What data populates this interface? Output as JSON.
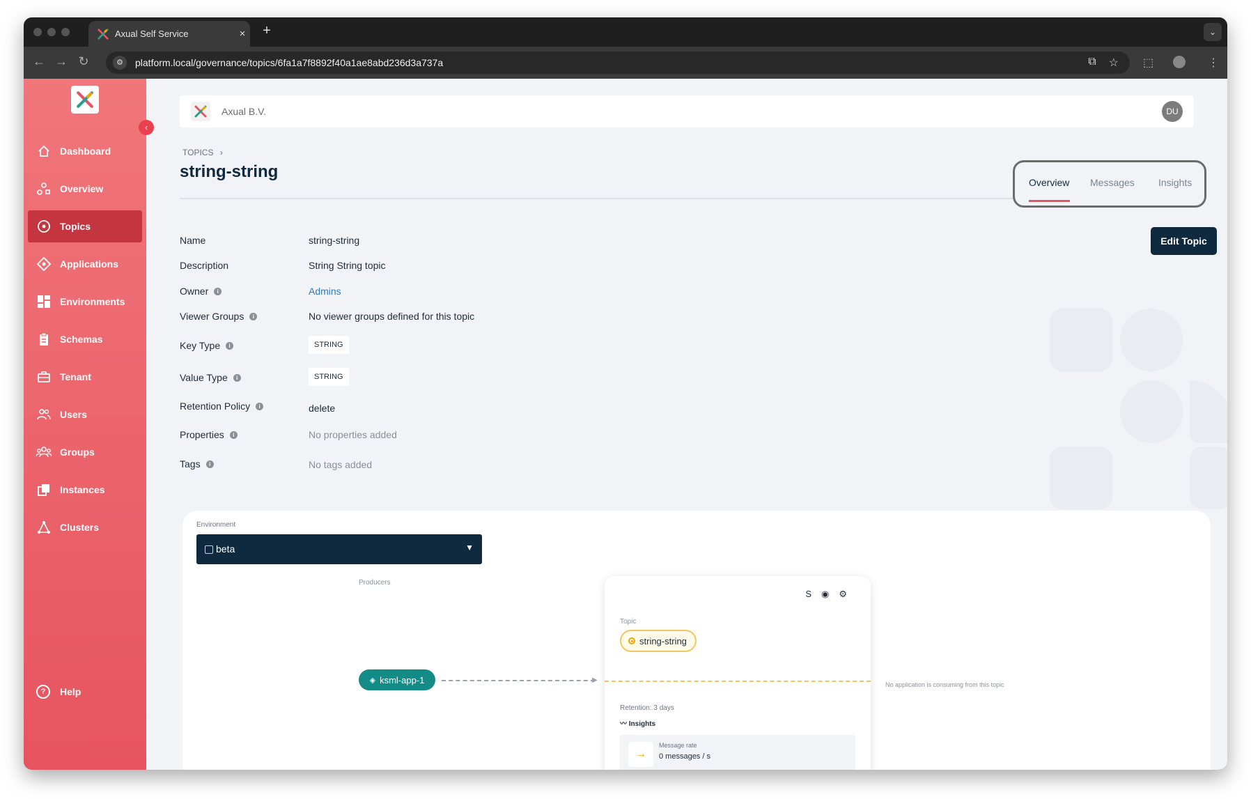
{
  "browser": {
    "tab_title": "Axual Self Service",
    "tab_close": "×",
    "new_tab": "+",
    "url": "platform.local/governance/topics/6fa1a7f8892f40a1ae8abd236d3a737a"
  },
  "sidebar": {
    "items": [
      {
        "label": "Dashboard",
        "icon": "home-icon"
      },
      {
        "label": "Overview",
        "icon": "overview-icon"
      },
      {
        "label": "Topics",
        "icon": "topics-icon",
        "active": true
      },
      {
        "label": "Applications",
        "icon": "applications-icon"
      },
      {
        "label": "Environments",
        "icon": "environments-icon"
      },
      {
        "label": "Schemas",
        "icon": "schemas-icon"
      },
      {
        "label": "Tenant",
        "icon": "tenant-icon"
      },
      {
        "label": "Users",
        "icon": "users-icon"
      },
      {
        "label": "Groups",
        "icon": "groups-icon"
      },
      {
        "label": "Instances",
        "icon": "instances-icon"
      },
      {
        "label": "Clusters",
        "icon": "clusters-icon"
      }
    ],
    "help_label": "Help",
    "help_icon": "?"
  },
  "header": {
    "org_name": "Axual B.V.",
    "avatar_initials": "DU"
  },
  "breadcrumb": {
    "label": "TOPICS",
    "separator": "›"
  },
  "page": {
    "title": "string-string",
    "tabs": [
      {
        "label": "Overview",
        "active": true
      },
      {
        "label": "Messages",
        "active": false
      },
      {
        "label": "Insights",
        "active": false
      }
    ],
    "edit_button": "Edit Topic"
  },
  "details": {
    "name_label": "Name",
    "name_value": "string-string",
    "description_label": "Description",
    "description_value": "String String topic",
    "owner_label": "Owner",
    "owner_value": "Admins",
    "viewer_groups_label": "Viewer Groups",
    "viewer_groups_value": "No viewer groups defined for this topic",
    "key_type_label": "Key Type",
    "key_type_value": "STRING",
    "value_type_label": "Value Type",
    "value_type_value": "STRING",
    "retention_label": "Retention Policy",
    "retention_value": "delete",
    "properties_label": "Properties",
    "properties_value": "No properties added",
    "tags_label": "Tags",
    "tags_value": "No tags added",
    "info_glyph": "i"
  },
  "graph": {
    "environment_label": "Environment",
    "environment_value": "beta",
    "producers_label": "Producers",
    "producer_app": "ksml-app-1",
    "topic_label": "Topic",
    "topic_name": "string-string",
    "retention": "Retention: 3 days",
    "insights_link": "Insights",
    "message_rate_label": "Message rate",
    "message_rate_value": "0 messages / s",
    "no_consumer": "No application is consuming from this topic",
    "card_icons": [
      "schema-icon",
      "eye-icon",
      "gear-icon"
    ]
  },
  "colors": {
    "sidebar_top": "#f0767a",
    "sidebar_bottom": "#e75460",
    "active_item": "#c5353f",
    "primary_dark": "#0f2a3f",
    "teal": "#138b87",
    "topic_yellow": "#f0c75e"
  }
}
